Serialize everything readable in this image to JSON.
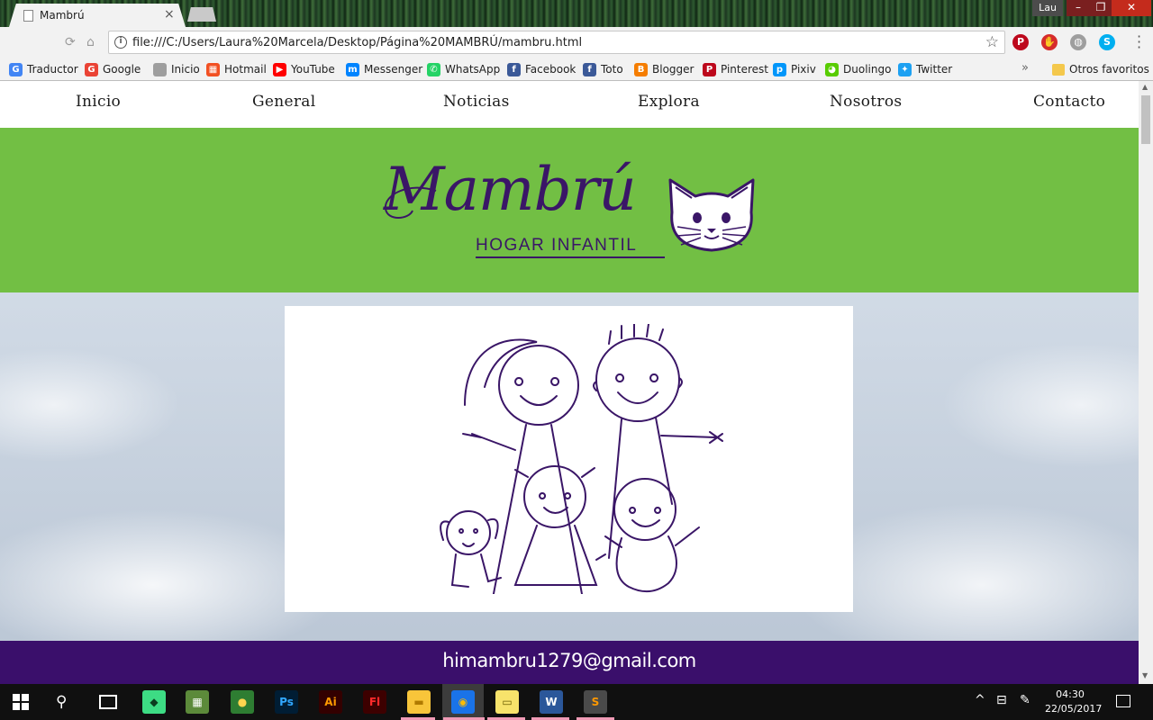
{
  "browser": {
    "tab_title": "Mambrú",
    "tab_close": "×",
    "user": "Lau",
    "window_controls": {
      "minimize": "–",
      "maximize": "❐",
      "close": "✕"
    },
    "url": "file:///C:/Users/Laura%20Marcela/Desktop/Página%20MAMBRÚ/mambru.html",
    "extensions": [
      "pinterest-icon",
      "evernote-icon",
      "ghostery-icon",
      "skype-icon"
    ],
    "bookmarks": [
      {
        "label": "Traductor",
        "icon": "translate-icon",
        "color": "#4285f4"
      },
      {
        "label": "Google",
        "icon": "google-icon",
        "color": "#ea4335"
      },
      {
        "label": "Inicio",
        "icon": "page-icon",
        "color": "#9e9e9e"
      },
      {
        "label": "Hotmail",
        "icon": "windows-icon",
        "color": "#f25022"
      },
      {
        "label": "YouTube",
        "icon": "youtube-icon",
        "color": "#ff0000"
      },
      {
        "label": "Messenger",
        "icon": "messenger-icon",
        "color": "#0084ff"
      },
      {
        "label": "WhatsApp",
        "icon": "whatsapp-icon",
        "color": "#25d366"
      },
      {
        "label": "Facebook",
        "icon": "facebook-icon",
        "color": "#3b5998"
      },
      {
        "label": "Toto",
        "icon": "facebook-icon",
        "color": "#3b5998"
      },
      {
        "label": "Blogger",
        "icon": "blogger-icon",
        "color": "#f57d00"
      },
      {
        "label": "Pinterest",
        "icon": "pinterest-icon",
        "color": "#bd081c"
      },
      {
        "label": "Pixiv",
        "icon": "pixiv-icon",
        "color": "#0096fa"
      },
      {
        "label": "Duolingo",
        "icon": "duolingo-icon",
        "color": "#58cc02"
      },
      {
        "label": "Twitter",
        "icon": "twitter-icon",
        "color": "#1da1f2"
      }
    ],
    "more_bookmarks": "»",
    "other_bookmarks": "Otros favoritos"
  },
  "site": {
    "nav": [
      "Inicio",
      "General",
      "Noticias",
      "Explora",
      "Nosotros",
      "Contacto"
    ],
    "logo_title": "Mambrú",
    "logo_subtitle": "HOGAR INFANTIL",
    "footer_email": "himambru1279@gmail.com",
    "colors": {
      "nav_bg": "#ffffff",
      "hero": "#72bf44",
      "brand_purple": "#3a1667",
      "footer": "#3a0f6b"
    }
  },
  "taskbar": {
    "apps": [
      {
        "name": "android-studio-icon",
        "glyph": "◆",
        "bg": "#3ddc84",
        "fg": "#0b3d1f"
      },
      {
        "name": "image-viewer-icon",
        "glyph": "▦",
        "bg": "#5c8a3a",
        "fg": "#fff"
      },
      {
        "name": "green-globe-icon",
        "glyph": "●",
        "bg": "#2e7d32",
        "fg": "#ffd54f"
      },
      {
        "name": "photoshop-icon",
        "glyph": "Ps",
        "bg": "#001d34",
        "fg": "#31a8ff"
      },
      {
        "name": "illustrator-icon",
        "glyph": "Ai",
        "bg": "#330000",
        "fg": "#ff9a00"
      },
      {
        "name": "flash-icon",
        "glyph": "Fl",
        "bg": "#3d0000",
        "fg": "#ff2a2a"
      },
      {
        "name": "file-explorer-icon",
        "glyph": "▬",
        "bg": "#f8c53a",
        "fg": "#b07a00"
      },
      {
        "name": "chrome-icon",
        "glyph": "◉",
        "bg": "#1a73e8",
        "fg": "#fbbc05"
      },
      {
        "name": "sticky-notes-icon",
        "glyph": "▭",
        "bg": "#f7e36b",
        "fg": "#6b5c00"
      },
      {
        "name": "word-icon",
        "glyph": "W",
        "bg": "#2b579a",
        "fg": "#fff"
      },
      {
        "name": "sublime-text-icon",
        "glyph": "S",
        "bg": "#4a4a4a",
        "fg": "#ff9800"
      }
    ],
    "time": "04:30",
    "date": "22/05/2017"
  }
}
